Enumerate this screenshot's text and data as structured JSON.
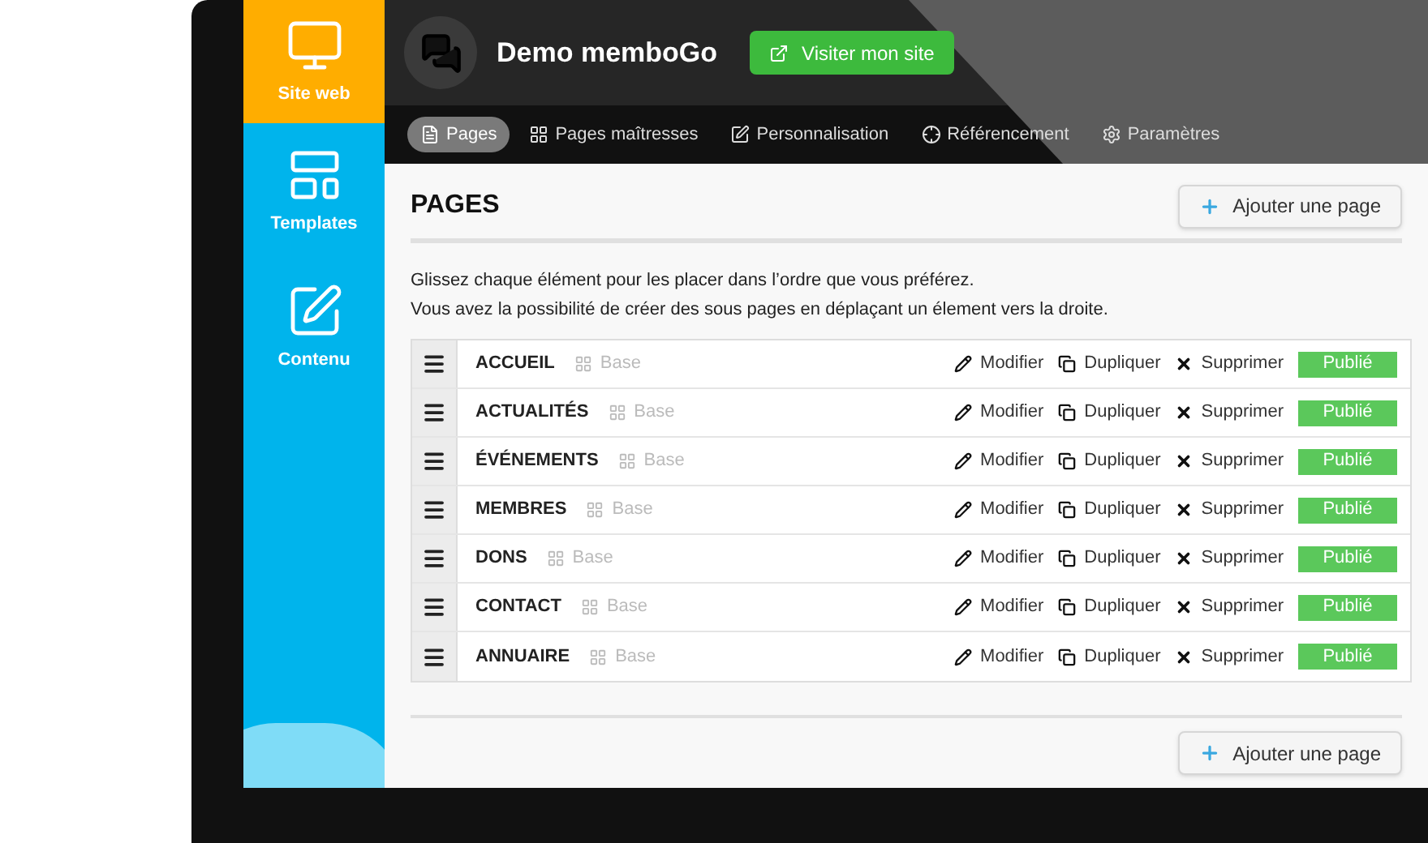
{
  "sidebar": {
    "items": [
      {
        "label": "Site web",
        "selected": true
      },
      {
        "label": "Templates",
        "selected": false
      },
      {
        "label": "Contenu",
        "selected": false
      }
    ]
  },
  "header": {
    "site_name": "Demo memboGo",
    "visit_button": "Visiter mon site"
  },
  "tabs": [
    {
      "label": "Pages",
      "selected": true
    },
    {
      "label": "Pages maîtresses",
      "selected": false
    },
    {
      "label": "Personnalisation",
      "selected": false
    },
    {
      "label": "Référencement",
      "selected": false
    },
    {
      "label": "Paramètres",
      "selected": false
    }
  ],
  "page": {
    "title": "PAGES",
    "add_button": "Ajouter une page",
    "instructions": [
      "Glissez chaque élément pour les placer dans l’ordre que vous préférez.",
      "Vous avez la possibilité de créer des sous pages en déplaçant un élement vers la droite."
    ],
    "bottom_add_button": "Ajouter une page"
  },
  "rows": [
    {
      "name": "ACCUEIL",
      "template": "Base",
      "actions": [
        "Modifier",
        "Dupliquer",
        "Supprimer"
      ],
      "status": "Publié"
    },
    {
      "name": "ACTUALITÉS",
      "template": "Base",
      "actions": [
        "Modifier",
        "Dupliquer",
        "Supprimer"
      ],
      "status": "Publié"
    },
    {
      "name": "ÉVÉNEMENTS",
      "template": "Base",
      "actions": [
        "Modifier",
        "Dupliquer",
        "Supprimer"
      ],
      "status": "Publié"
    },
    {
      "name": "MEMBRES",
      "template": "Base",
      "actions": [
        "Modifier",
        "Dupliquer",
        "Supprimer"
      ],
      "status": "Publié"
    },
    {
      "name": "DONS",
      "template": "Base",
      "actions": [
        "Modifier",
        "Dupliquer",
        "Supprimer"
      ],
      "status": "Publié"
    },
    {
      "name": "CONTACT",
      "template": "Base",
      "actions": [
        "Modifier",
        "Dupliquer",
        "Supprimer"
      ],
      "status": "Publié"
    },
    {
      "name": "ANNUAIRE",
      "template": "Base",
      "actions": [
        "Modifier",
        "Dupliquer",
        "Supprimer"
      ],
      "status": "Publié"
    }
  ]
}
